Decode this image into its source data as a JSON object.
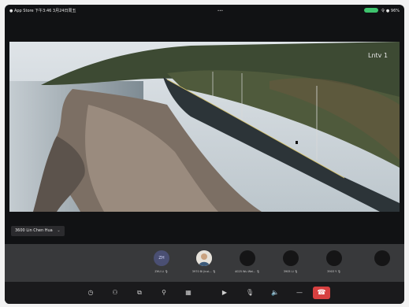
{
  "status_bar": {
    "left": "● App Store  下午3:46  3月24日周五",
    "center": "•••",
    "right": "令 ● 96%"
  },
  "video": {
    "watermark": "Lntv 1"
  },
  "name_tag": {
    "label": "3600 Lin Chen Hua",
    "chevron": "⌄"
  },
  "participants": [
    {
      "initials": "ZH",
      "name": "ZHU Li  🎙"
    },
    {
      "initials": "",
      "name": "3970 Bi Jinzi...  🎙"
    },
    {
      "initials": "",
      "name": "4025 Wu Wei...  🎙"
    },
    {
      "initials": "",
      "name": "3905 Li  🎙"
    },
    {
      "initials": "",
      "name": "3903 Y  🎙"
    },
    {
      "initials": "",
      "name": ""
    }
  ],
  "toolbar": {
    "icons": [
      "clock-icon",
      "people-icon",
      "screen-share-icon",
      "link-icon",
      "grid-icon",
      "camera-icon",
      "mic-icon",
      "speaker-icon",
      "more-icon",
      "hang-up-icon"
    ],
    "glyphs": [
      "◷",
      "⚇",
      "⧉",
      "⚲",
      "▦",
      "▶",
      "🎙",
      "🔈",
      "—",
      "☎"
    ]
  }
}
